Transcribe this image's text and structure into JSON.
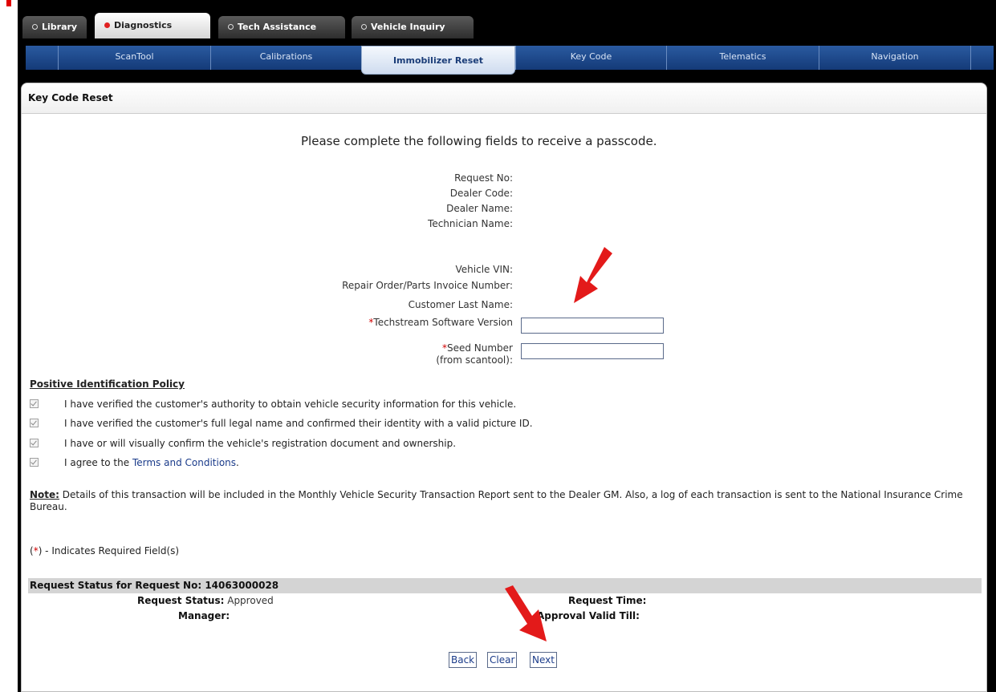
{
  "top_tabs": [
    {
      "label": "Library"
    },
    {
      "label": "Diagnostics"
    },
    {
      "label": "Tech Assistance"
    },
    {
      "label": "Vehicle Inquiry"
    }
  ],
  "sub_nav": [
    {
      "label": "ScanTool"
    },
    {
      "label": "Calibrations"
    },
    {
      "label": "Immobilizer Reset"
    },
    {
      "label": "Key Code"
    },
    {
      "label": "Telematics"
    },
    {
      "label": "Navigation"
    }
  ],
  "panel": {
    "title": "Key Code Reset",
    "instructions": "Please complete the following fields to receive a passcode."
  },
  "info_fields": {
    "request_no": "Request No:",
    "dealer_code": "Dealer Code:",
    "dealer_name": "Dealer Name:",
    "technician_name": "Technician Name:",
    "vehicle_vin": "Vehicle VIN:",
    "repair_order": "Repair Order/Parts Invoice Number:",
    "customer_last_name": "Customer Last Name:"
  },
  "inputs": {
    "required_mark": "*",
    "techstream_label": "Techstream Software Version",
    "techstream_value": "",
    "seed_label": "Seed Number",
    "seed_sublabel": "(from scantool):",
    "seed_value": ""
  },
  "policy": {
    "heading": "Positive Identification Policy",
    "items": [
      "I have verified the customer's authority to obtain vehicle security information for this vehicle.",
      "I have verified the customer's full legal name and confirmed their identity with a valid picture ID.",
      "I have or will visually confirm the vehicle's registration document and ownership."
    ],
    "terms_prefix": "I agree to the ",
    "terms_link": "Terms and Conditions",
    "terms_suffix": "."
  },
  "note": {
    "label": "Note:",
    "text": " Details of this transaction will be included in the Monthly Vehicle Security Transaction Report sent to the Dealer GM. Also, a log of each transaction is sent to the National Insurance Crime Bureau."
  },
  "required_note": {
    "open": "(",
    "mark": "*",
    "text": ") - Indicates Required Field(s)"
  },
  "status": {
    "header": "Request Status for Request No: 14063000028",
    "request_status_label": "Request Status:",
    "request_status_value": "Approved",
    "manager_label": "Manager:",
    "request_time_label": "Request Time:",
    "approval_valid_label": "Approval Valid Till:"
  },
  "buttons": {
    "back": "Back",
    "clear": "Clear",
    "next": "Next"
  },
  "colors": {
    "arrow": "#e31a1a",
    "nav_blue": "#1b3d78",
    "required_red": "#d00000"
  }
}
